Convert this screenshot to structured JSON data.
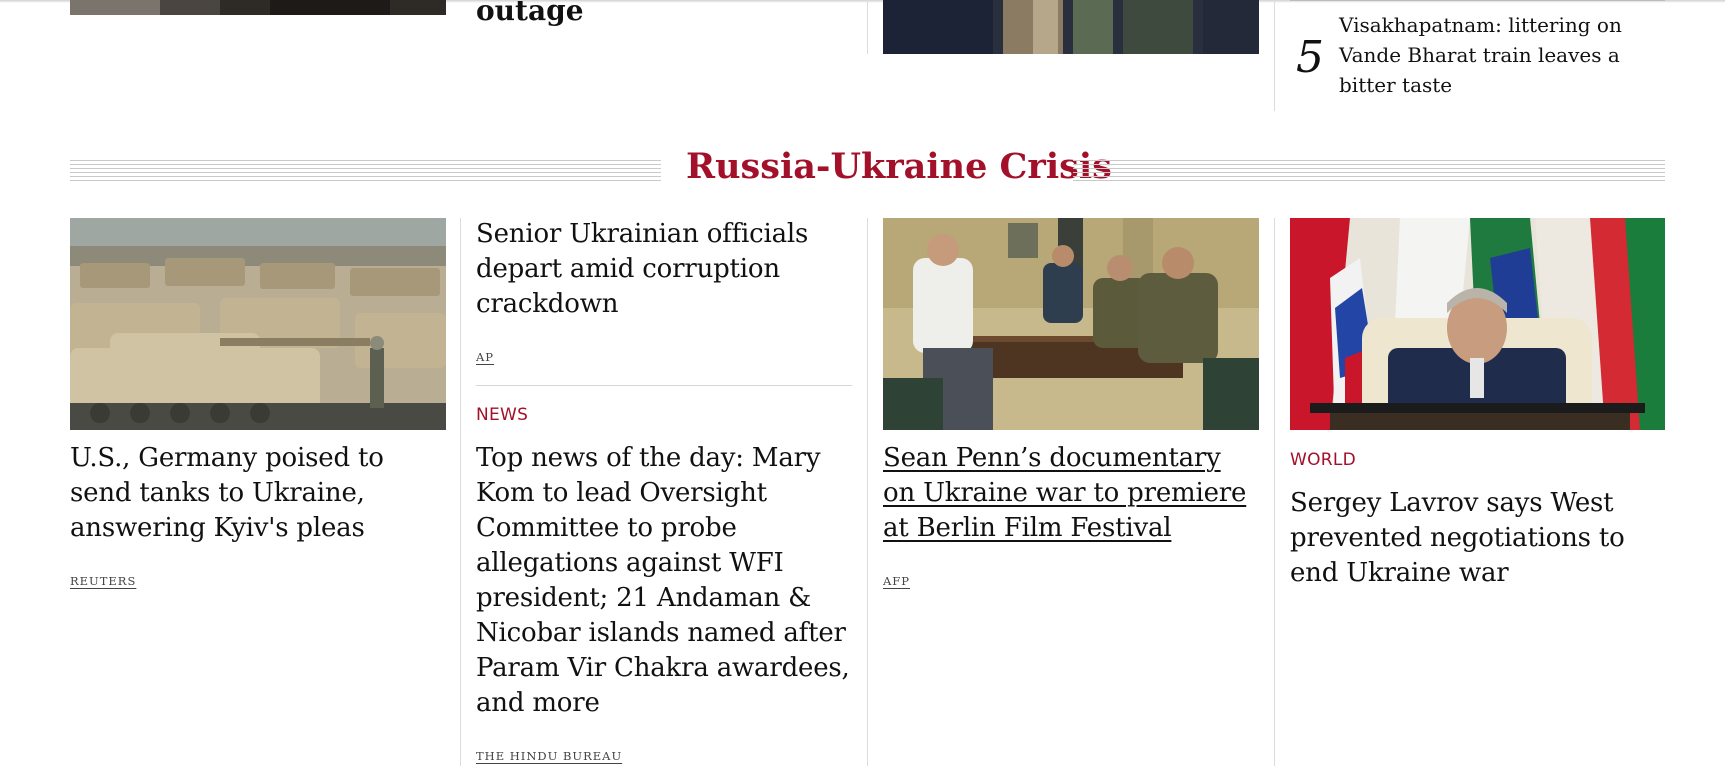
{
  "top_strip": {
    "partial_headline": "outage",
    "trending_rank": "5",
    "trending_headline": "Visakhapatnam: littering on Vande Bharat train leaves a bitter taste"
  },
  "section": {
    "title": "Russia-Ukraine Crisis"
  },
  "stories": {
    "col1": {
      "headline": "U.S., Germany poised to send tanks to Ukraine, answering Kyiv's pleas",
      "source": "REUTERS"
    },
    "col2_top": {
      "headline": "Senior Ukrainian officials depart amid corruption crackdown",
      "source": "AP"
    },
    "col2_bottom": {
      "kicker": "NEWS",
      "headline": "Top news of the day: Mary Kom to lead Oversight Committee to probe allegations against WFI president; 21 Andaman & Nicobar islands named after Param Vir Chakra awardees, and more",
      "source": "THE HINDU BUREAU"
    },
    "col3": {
      "headline": "Sean Penn’s documentary on Ukraine war to premiere at Berlin Film Festival",
      "source": "AFP"
    },
    "col4": {
      "kicker": "WORLD",
      "headline": "Sergey Lavrov says West prevented negotiations to end Ukraine war"
    }
  },
  "colors": {
    "accent": "#a3102a",
    "text": "#111111",
    "divider": "#dcdcdc"
  }
}
